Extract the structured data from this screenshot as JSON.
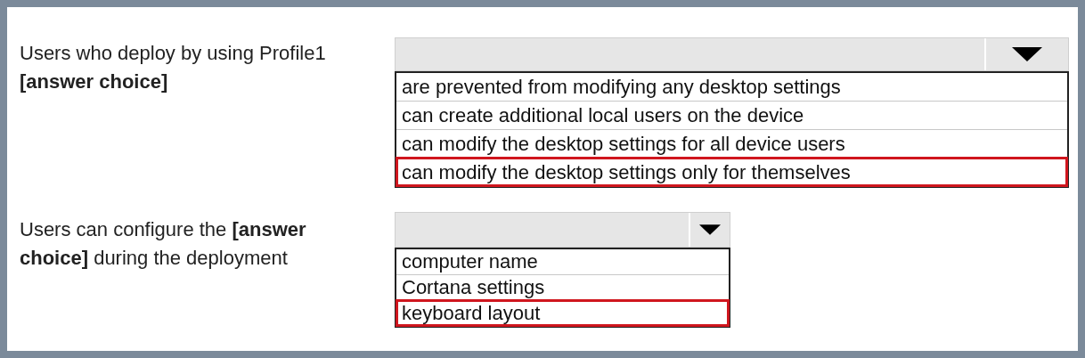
{
  "questions": [
    {
      "statement": "Users who deploy by using Profile1 **[answer choice]**",
      "options": [
        {
          "label": "are prevented from modifying any desktop settings",
          "selected": false
        },
        {
          "label": "can create additional local users on the device",
          "selected": false
        },
        {
          "label": "can modify the desktop settings for all device users",
          "selected": false
        },
        {
          "label": "can modify the desktop settings only for themselves",
          "selected": true
        }
      ]
    },
    {
      "statement": "Users can configure the **[answer choice]** during the deployment",
      "options": [
        {
          "label": "computer name",
          "selected": false
        },
        {
          "label": "Cortana settings",
          "selected": false
        },
        {
          "label": "keyboard layout",
          "selected": true
        }
      ]
    }
  ]
}
